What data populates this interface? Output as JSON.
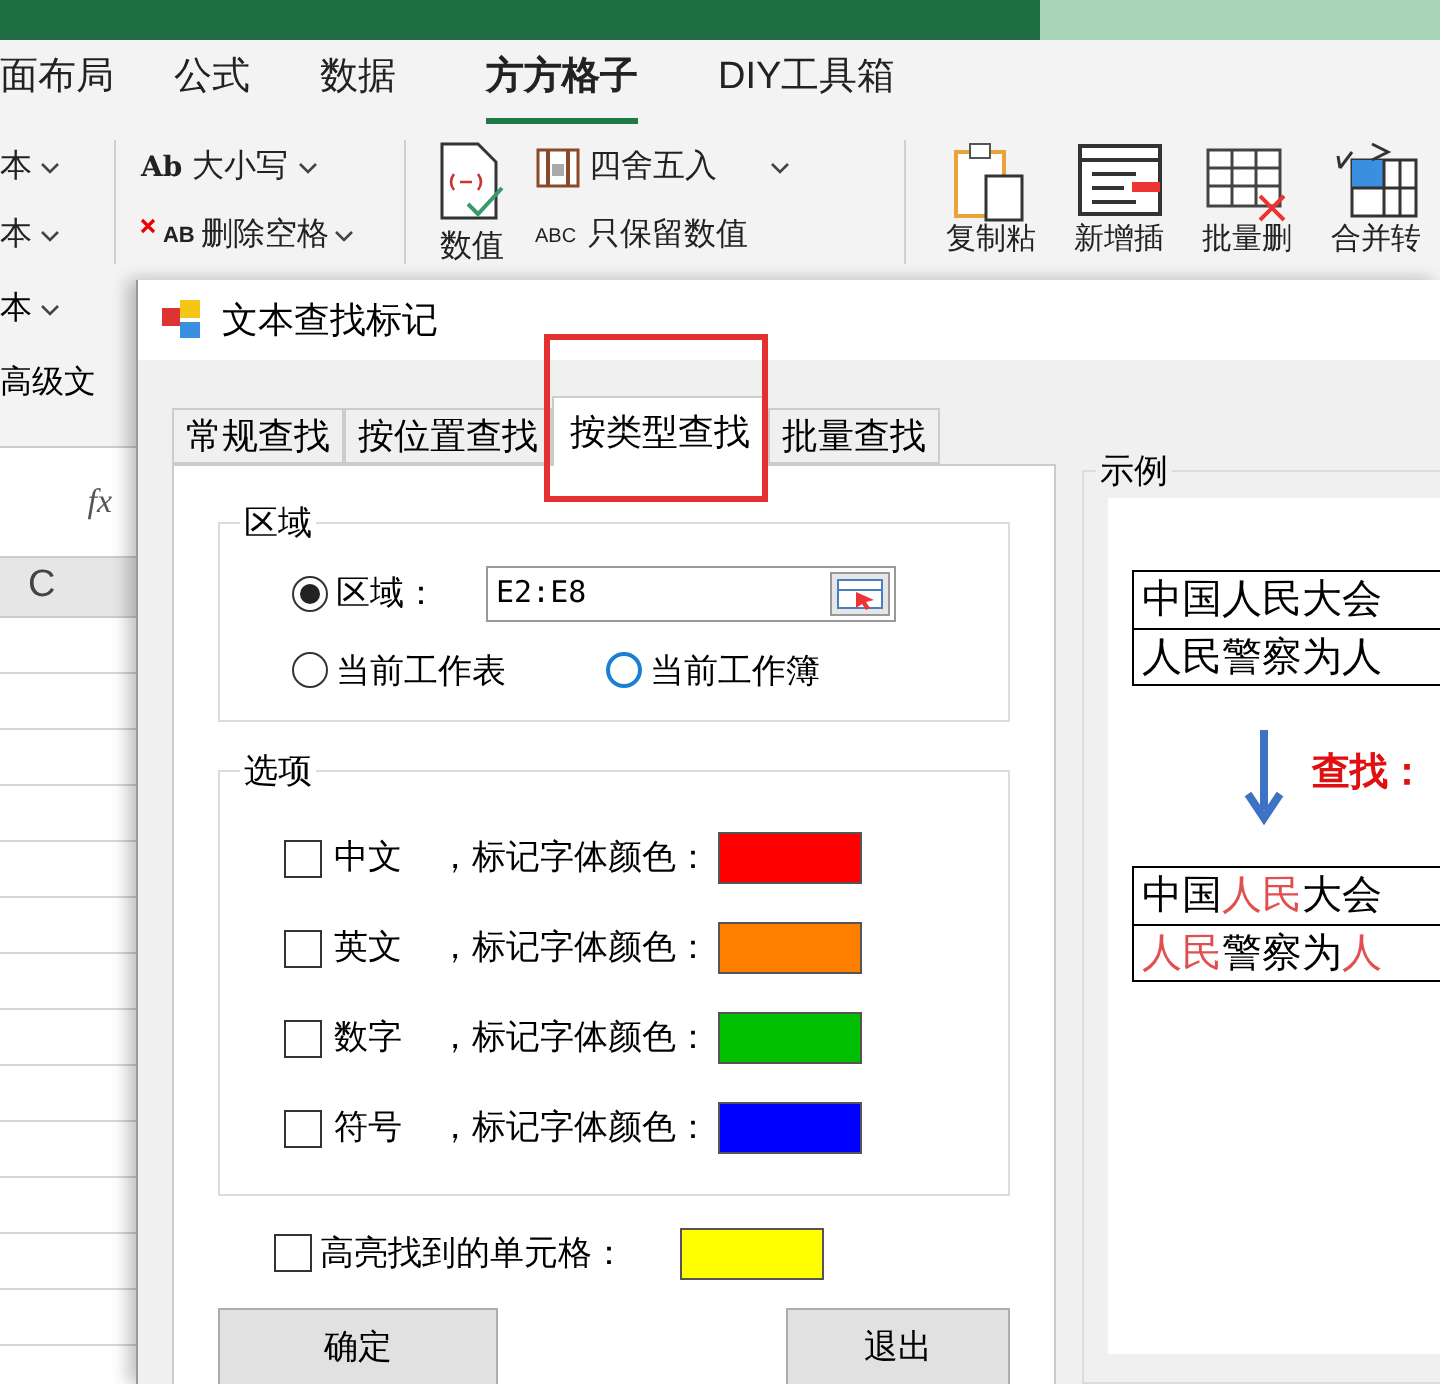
{
  "ribbon_tabs": [
    {
      "label": "面布局",
      "selected": false
    },
    {
      "label": "公式",
      "selected": false
    },
    {
      "label": "数据",
      "selected": false
    },
    {
      "label": "方方格子",
      "selected": true
    },
    {
      "label": "DIY工具箱",
      "selected": false
    }
  ],
  "ribbon": {
    "text_menus": [
      "本",
      "本"
    ],
    "case_icon": "Ab",
    "case_button": "大小写",
    "trim_icon": "AB",
    "trim_button": "删除空格",
    "value_button": "数值",
    "round_button": "四舍五入",
    "keep_icon": "ABC",
    "keep_button": "只保留数值",
    "big_buttons": [
      "复制粘",
      "新增插",
      "批量删",
      "合并转"
    ]
  },
  "sheet": {
    "text_menu": "本",
    "advanced_text": "高级文",
    "fx": "fx",
    "column_header": "C"
  },
  "dialog": {
    "title": "文本查找标记",
    "tabs": [
      {
        "label": "常规查找",
        "selected": false
      },
      {
        "label": "按位置查找",
        "selected": false
      },
      {
        "label": "按类型查找",
        "selected": true
      },
      {
        "label": "批量查找",
        "selected": false
      }
    ],
    "region": {
      "label": "区域",
      "options": [
        {
          "label": "区域：",
          "selected": true,
          "kind": "range"
        },
        {
          "label": "当前工作表",
          "selected": false,
          "kind": "plain"
        },
        {
          "label": "当前工作簿",
          "selected": false,
          "hovered": true,
          "kind": "plain"
        }
      ],
      "range_value": "E2:E8"
    },
    "options": {
      "label": "选项",
      "items": [
        {
          "label": "中文",
          "checked": false,
          "caption": "，标记字体颜色：",
          "color": "#ff0000"
        },
        {
          "label": "英文",
          "checked": false,
          "caption": "，标记字体颜色：",
          "color": "#ff8000"
        },
        {
          "label": "数字",
          "checked": false,
          "caption": "，标记字体颜色：",
          "color": "#00c000"
        },
        {
          "label": "符号",
          "checked": false,
          "caption": "，标记字体颜色：",
          "color": "#0000ff"
        }
      ]
    },
    "highlight": {
      "label": "高亮找到的单元格：",
      "checked": false,
      "color": "#ffff00"
    },
    "buttons": [
      "确定",
      "退出"
    ],
    "example": {
      "label": "示例",
      "before": [
        "中国人民大会",
        "人民警察为人"
      ],
      "find_label": "查找：",
      "after": [
        [
          {
            "text": "中国",
            "marked": false
          },
          {
            "text": "人民",
            "marked": true
          },
          {
            "text": "大会",
            "marked": false
          }
        ],
        [
          {
            "text": "人民",
            "marked": true
          },
          {
            "text": "警察为",
            "marked": false
          },
          {
            "text": "人",
            "marked": true
          }
        ]
      ]
    }
  }
}
